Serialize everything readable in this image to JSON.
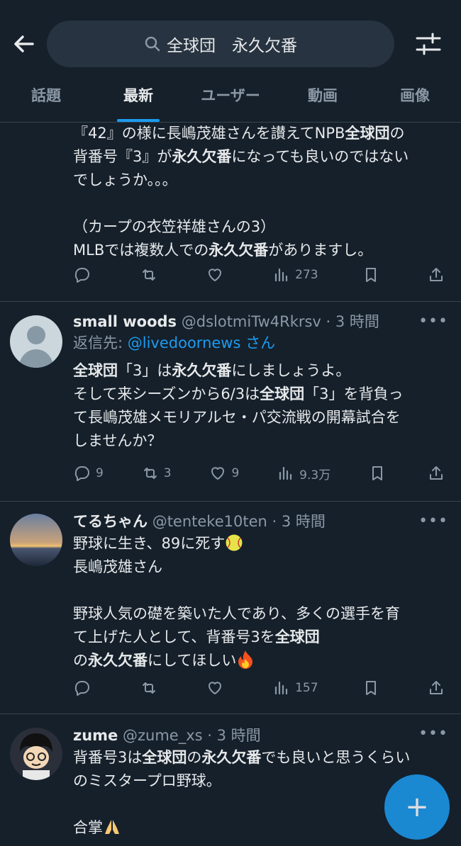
{
  "search": {
    "query": "全球団　永久欠番"
  },
  "tabs": [
    "話題",
    "最新",
    "ユーザー",
    "動画",
    "画像"
  ],
  "tweets": [
    {
      "lines": [
        [
          "『42』の様に長嶋茂雄さんを讃えてNPB",
          "b:全球団",
          "の"
        ],
        [
          "背番号『3』が",
          "b:永久欠番",
          "になっても良いのではない"
        ],
        [
          "でしょうか。。。"
        ],
        [
          ""
        ],
        [
          "（カープの衣笠祥雄さんの3）"
        ],
        [
          "MLBでは複数人での",
          "b:永久欠番",
          "がありますし。"
        ]
      ],
      "counts": {
        "reply": "",
        "retweet": "",
        "like": "",
        "views": "273"
      }
    },
    {
      "name": "small woods",
      "handle": "@dslotmiTw4Rkrsv",
      "time": "· 3 時間",
      "reply_prefix": "返信先: ",
      "reply_target": "@livedoornews さん",
      "lines": [
        [
          "b:全球団",
          "「3」は",
          "b:永久欠番",
          "にしましょうよ。"
        ],
        [
          "そして来シーズンから6/3は",
          "b:全球団",
          "「3」を背負っ"
        ],
        [
          "て長嶋茂雄メモリアルセ・パ交流戦の開幕試合を"
        ],
        [
          "しませんか？"
        ]
      ],
      "counts": {
        "reply": "9",
        "retweet": "3",
        "like": "9",
        "views": "9.3万"
      }
    },
    {
      "name": "てるちゃん",
      "handle": "@tenteke10ten",
      "time": "· 3 時間",
      "lines": [
        [
          "野球に生き、89に死す",
          "e:softball"
        ],
        [
          "長嶋茂雄さん"
        ],
        [
          ""
        ],
        [
          "野球人気の礎を築いた人であり、多くの選手を育"
        ],
        [
          "て上げた人として、背番号3を",
          "b:全球団"
        ],
        [
          "の",
          "b:永久欠番",
          "にしてほしい",
          "e:fire"
        ]
      ],
      "counts": {
        "reply": "",
        "retweet": "",
        "like": "",
        "views": "157"
      }
    },
    {
      "name": "zume",
      "handle": "@zume_xs",
      "time": "· 3 時間",
      "lines": [
        [
          "背番号3は",
          "b:全球団",
          "の",
          "b:永久欠番",
          "でも良いと思うくらい"
        ],
        [
          "のミスタープロ野球。"
        ],
        [
          ""
        ],
        [
          "合掌",
          "e:pray"
        ]
      ]
    }
  ],
  "fab_label": "+",
  "more_label": "•••",
  "colors": {
    "background": "#15202b",
    "accent": "#1d9bf0",
    "muted": "#8b98a5",
    "divider": "#38444d"
  }
}
